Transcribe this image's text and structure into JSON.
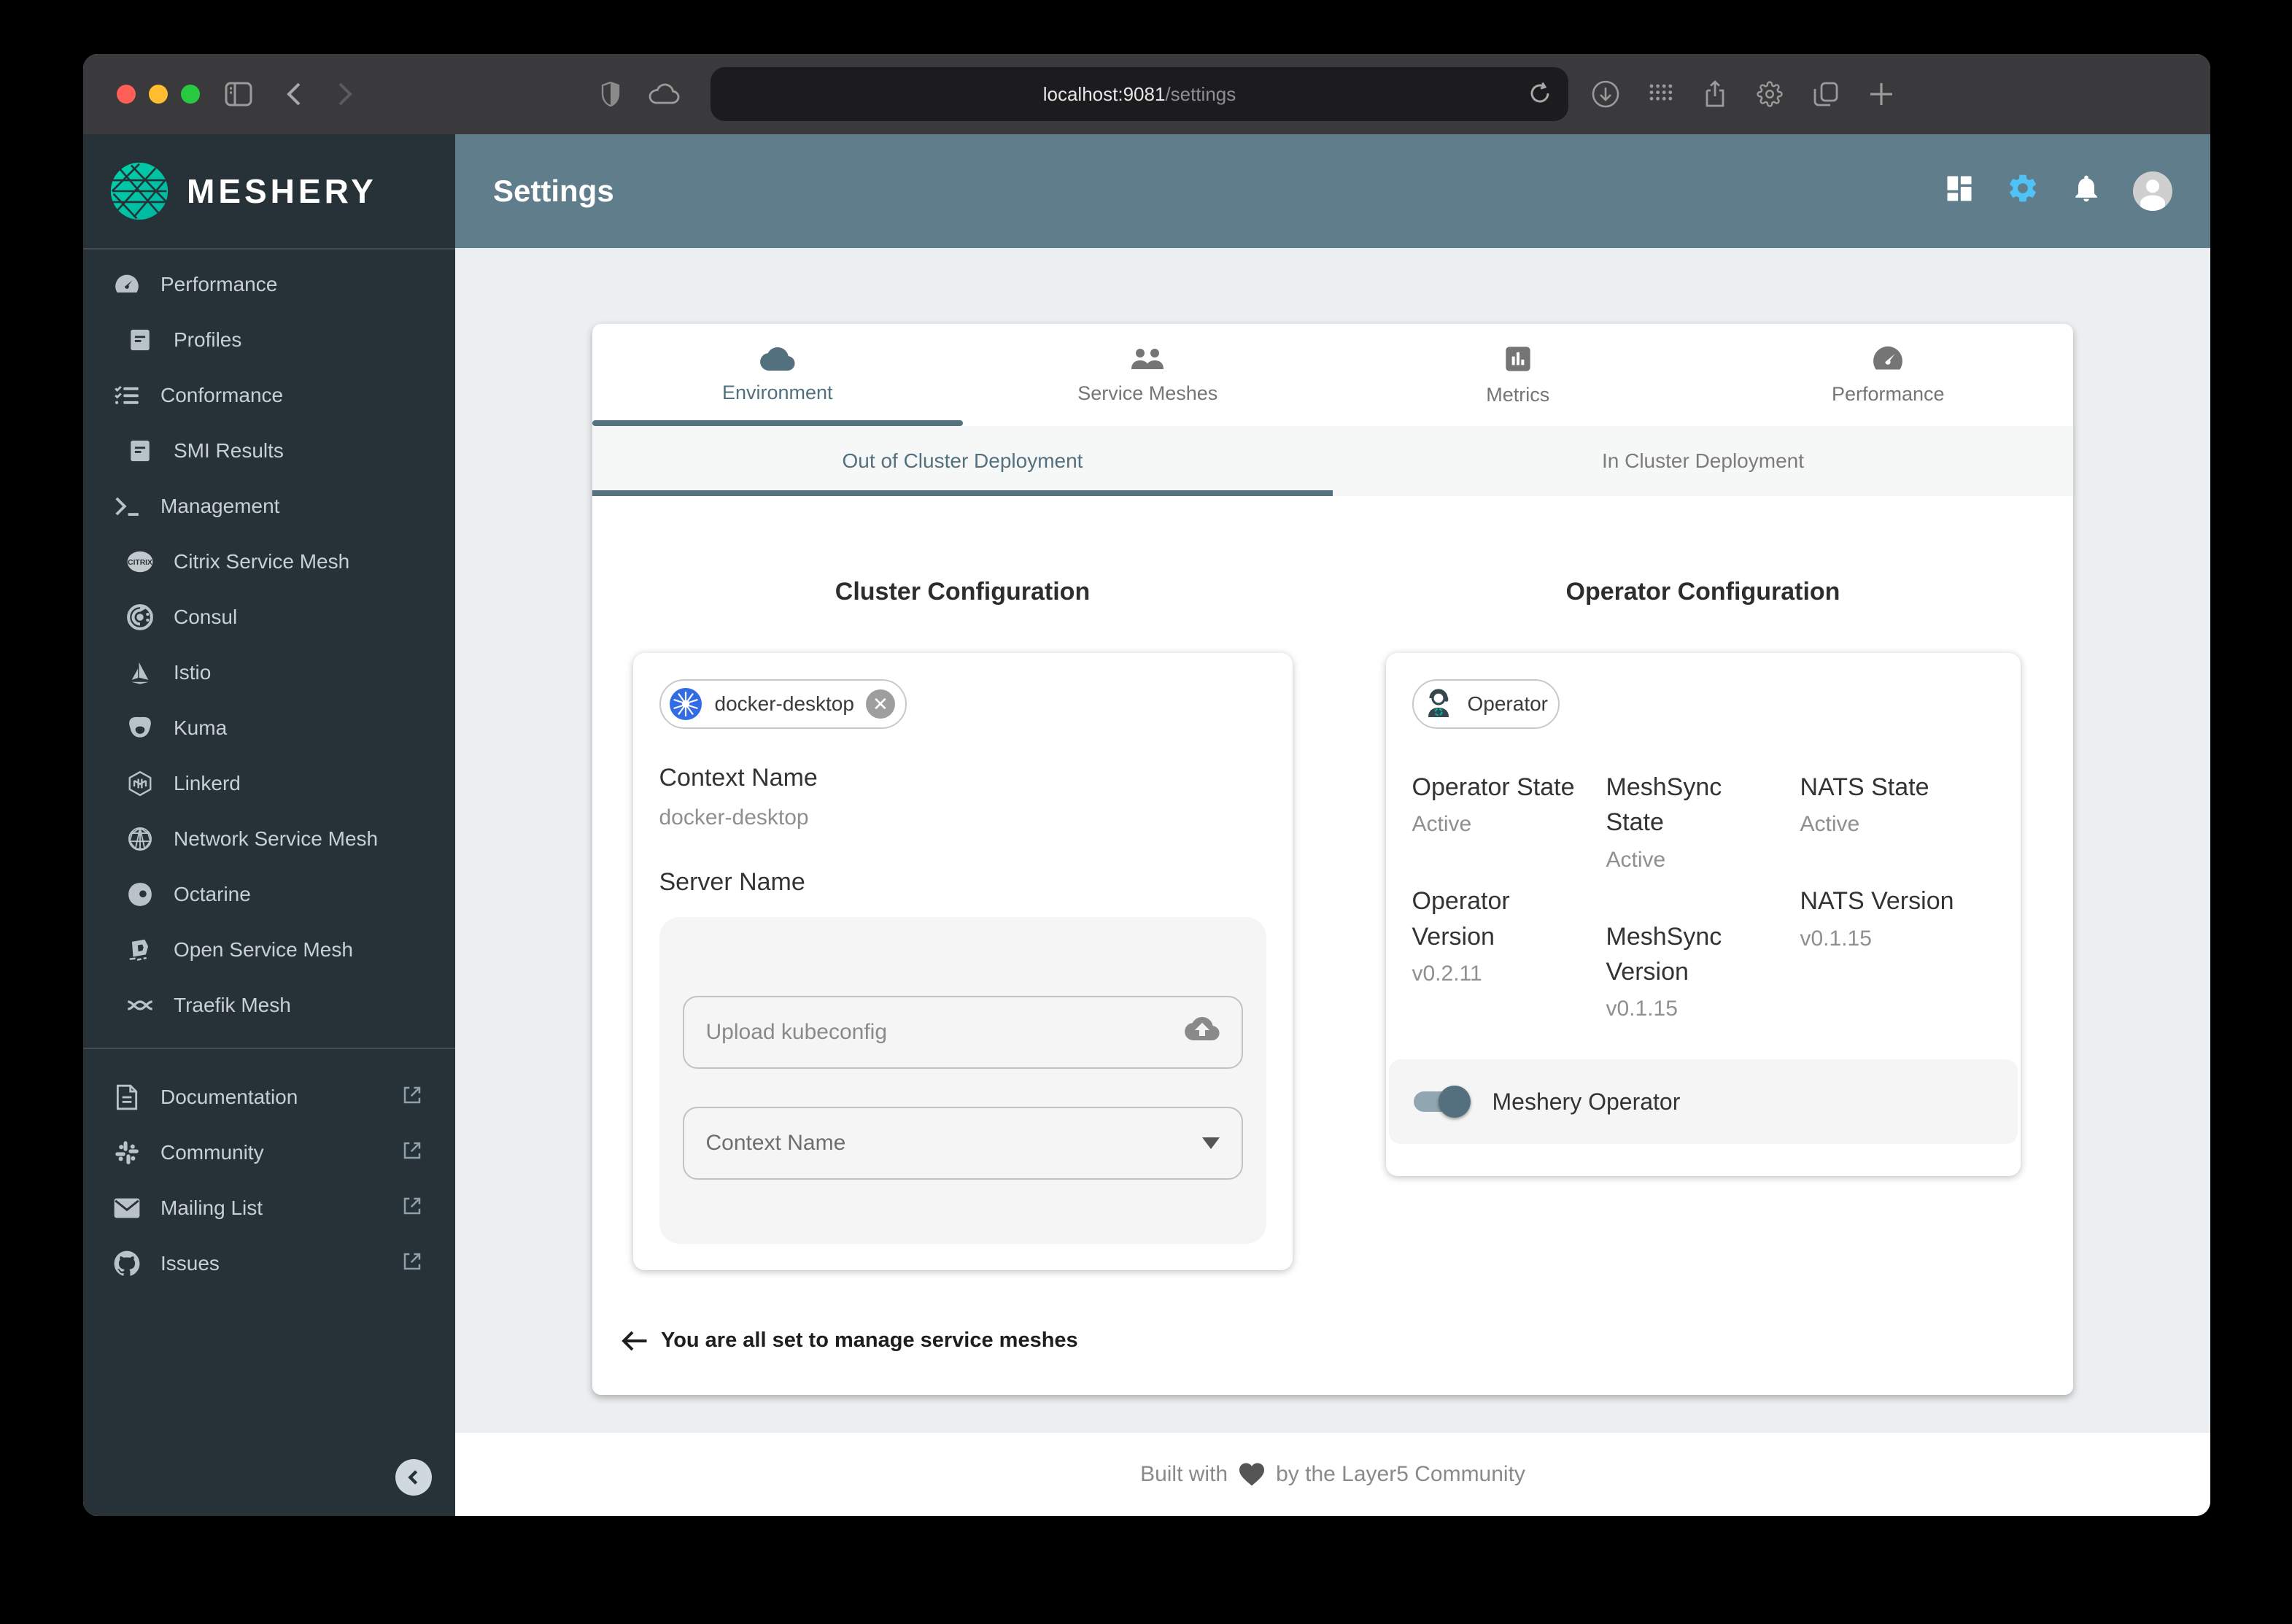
{
  "browser": {
    "url_host": "localhost:9081",
    "url_path": "/settings"
  },
  "sidebar": {
    "brand": "MESHERY",
    "items": [
      {
        "label": "Performance",
        "icon": "gauge"
      },
      {
        "label": "Profiles",
        "icon": "document"
      },
      {
        "label": "Conformance",
        "icon": "checklist"
      },
      {
        "label": "SMI Results",
        "icon": "document"
      },
      {
        "label": "Management",
        "icon": "terminal"
      },
      {
        "label": "Citrix Service Mesh",
        "icon": "citrix-logo"
      },
      {
        "label": "Consul",
        "icon": "consul-logo"
      },
      {
        "label": "Istio",
        "icon": "istio-logo"
      },
      {
        "label": "Kuma",
        "icon": "kuma-logo"
      },
      {
        "label": "Linkerd",
        "icon": "linkerd-logo"
      },
      {
        "label": "Network Service Mesh",
        "icon": "nsm-logo"
      },
      {
        "label": "Octarine",
        "icon": "octarine-logo"
      },
      {
        "label": "Open Service Mesh",
        "icon": "osm-logo"
      },
      {
        "label": "Traefik Mesh",
        "icon": "traefik-logo"
      }
    ],
    "links": [
      {
        "label": "Documentation",
        "icon": "doc"
      },
      {
        "label": "Community",
        "icon": "slack"
      },
      {
        "label": "Mailing List",
        "icon": "mail"
      },
      {
        "label": "Issues",
        "icon": "github"
      }
    ]
  },
  "header": {
    "title": "Settings"
  },
  "tabs": [
    {
      "label": "Environment"
    },
    {
      "label": "Service Meshes"
    },
    {
      "label": "Metrics"
    },
    {
      "label": "Performance"
    }
  ],
  "subtabs": [
    "Out of Cluster Deployment",
    "In Cluster Deployment"
  ],
  "cluster": {
    "title": "Cluster Configuration",
    "chip": "docker-desktop",
    "context_label": "Context Name",
    "context_value": "docker-desktop",
    "server_label": "Server Name",
    "upload_placeholder": "Upload kubeconfig",
    "select_label": "Context Name"
  },
  "operator": {
    "title": "Operator Configuration",
    "chip": "Operator",
    "fields": [
      {
        "label": "Operator State",
        "value": "Active"
      },
      {
        "label": "MeshSync State",
        "value": "Active"
      },
      {
        "label": "NATS State",
        "value": "Active"
      },
      {
        "label": "Operator Version",
        "value": "v0.2.11"
      },
      {
        "label": "MeshSync Version",
        "value": "v0.1.15"
      },
      {
        "label": "NATS Version",
        "value": "v0.1.15"
      }
    ],
    "toggle_label": "Meshery Operator"
  },
  "status": "You are all set to manage service meshes",
  "footer": {
    "prefix": "Built with",
    "suffix": "by the Layer5 Community"
  },
  "colors": {
    "brand": "#00b39f",
    "header": "#607d8b",
    "accent_gear": "#4fc3f7",
    "indicator": "#56727f",
    "kubernetes": "#326ce5",
    "sidebar": "#263238"
  }
}
